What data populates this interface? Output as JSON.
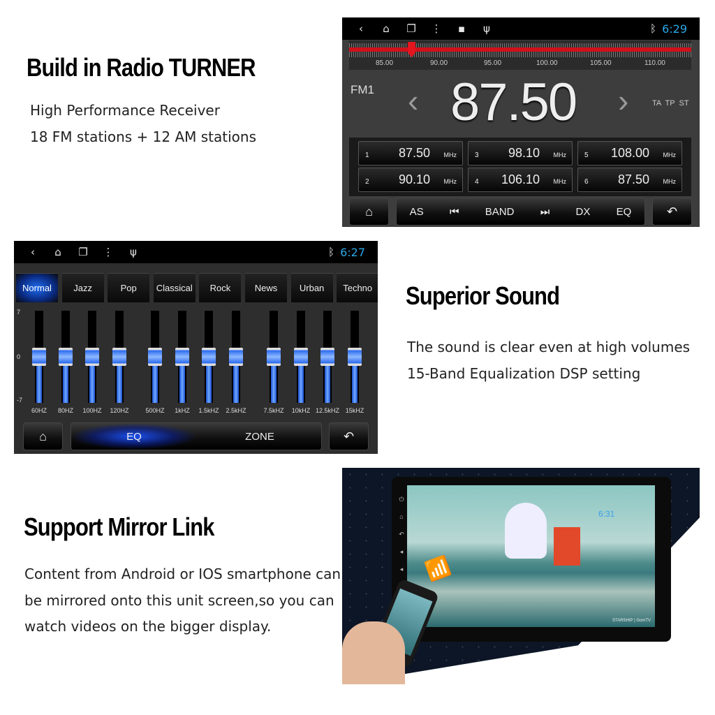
{
  "section_radio": {
    "title": "Build in Radio TURNER",
    "lines": [
      "High Performance Receiver",
      "18 FM stations + 12 AM stations"
    ]
  },
  "radio_screen": {
    "status": {
      "icons": [
        "back-icon",
        "home-icon",
        "recent-apps-icon",
        "more-icon",
        "image-icon",
        "usb-icon"
      ],
      "bluetooth": "bluetooth-icon",
      "time": "6:29"
    },
    "scale_labels": [
      "85.00",
      "90.00",
      "95.00",
      "100.00",
      "105.00",
      "110.00"
    ],
    "band": "FM1",
    "frequency": "87.50",
    "flags": "TA  TP  ST",
    "presets": [
      {
        "num": "1",
        "freq": "87.50",
        "unit": "MHz"
      },
      {
        "num": "2",
        "freq": "90.10",
        "unit": "MHz"
      },
      {
        "num": "3",
        "freq": "98.10",
        "unit": "MHz"
      },
      {
        "num": "4",
        "freq": "106.10",
        "unit": "MHz"
      },
      {
        "num": "5",
        "freq": "108.00",
        "unit": "MHz"
      },
      {
        "num": "6",
        "freq": "87.50",
        "unit": "MHz"
      }
    ],
    "controls": {
      "as": "AS",
      "band": "BAND",
      "dx": "DX",
      "eq": "EQ"
    },
    "accent": "#d0101a"
  },
  "eq_screen": {
    "status": {
      "time": "6:27"
    },
    "presets": [
      "Normal",
      "Jazz",
      "Pop",
      "Classical",
      "Rock",
      "News",
      "Urban",
      "Techno"
    ],
    "active_preset": "Normal",
    "axis": {
      "max": "7",
      "mid": "0",
      "min": "-7"
    },
    "bands": [
      {
        "label": "60HZ",
        "value": 0
      },
      {
        "label": "80HZ",
        "value": 0
      },
      {
        "label": "100HZ",
        "value": 0
      },
      {
        "label": "120HZ",
        "value": 0
      },
      {
        "label": "500HZ",
        "value": 0
      },
      {
        "label": "1kHZ",
        "value": 0
      },
      {
        "label": "1.5kHZ",
        "value": 0
      },
      {
        "label": "2.5kHZ",
        "value": 0
      },
      {
        "label": "7.5kHZ",
        "value": 0
      },
      {
        "label": "10kHZ",
        "value": 0
      },
      {
        "label": "12.5kHZ",
        "value": 0
      },
      {
        "label": "15kHZ",
        "value": 0
      }
    ],
    "tabs": {
      "eq": "EQ",
      "zone": "ZONE"
    },
    "accent": "#1e6cf0"
  },
  "section_sound": {
    "title": "Superior Sound",
    "lines": [
      "The sound is clear even at high volumes",
      "15-Band Equalization DSP setting"
    ]
  },
  "section_mirror": {
    "title": "Support Mirror Link",
    "lines": [
      "Content from Android or IOS smartphone can",
      "be mirrored onto this unit screen,so you can",
      "watch videos on the  bigger display."
    ],
    "screen_time": "6:31",
    "watermark": "STARSHIP | GomTV"
  }
}
